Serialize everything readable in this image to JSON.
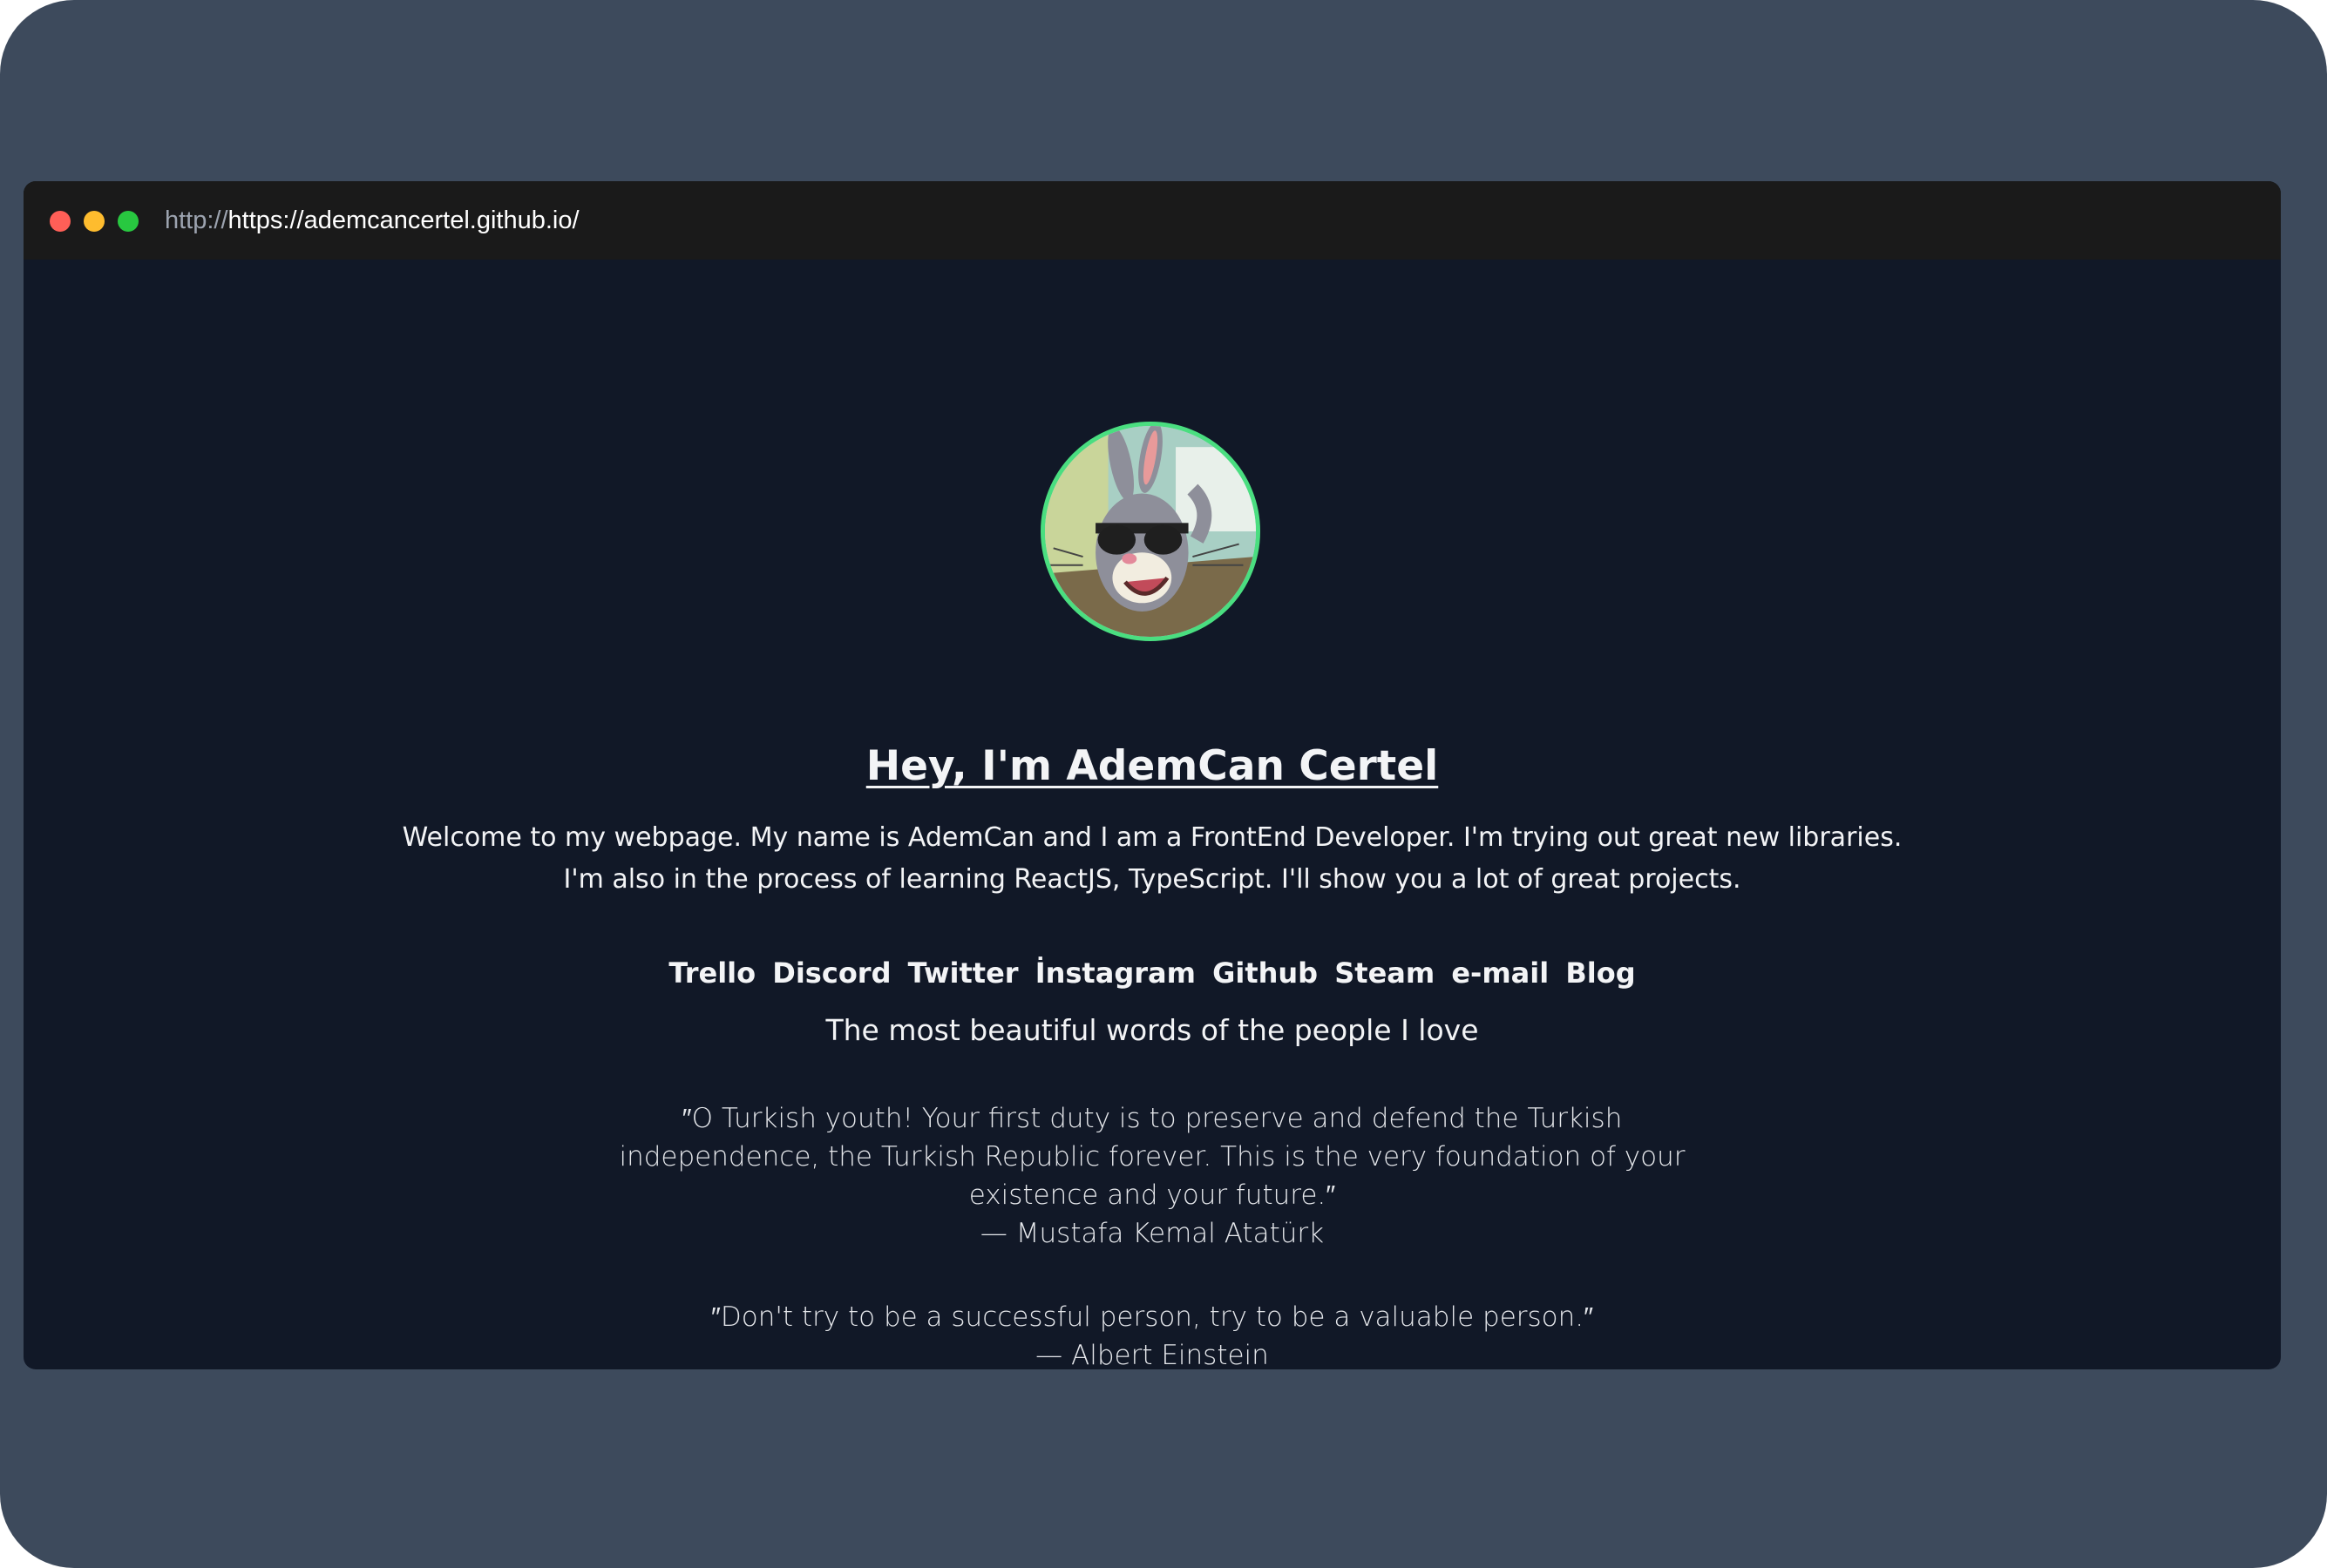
{
  "browser": {
    "url_protocol": "http://",
    "url_host": "https://ademcancertel.github.io/"
  },
  "profile": {
    "heading": "Hey, I'm AdemCan Certel",
    "intro_line1": "Welcome to my webpage. My name is AdemCan and I am a FrontEnd Developer. I'm trying out great new libraries.",
    "intro_line2": "I'm also in the process of learning ReactJS, TypeScript. I'll show you a lot of great projects."
  },
  "social_links": [
    "Trello",
    "Discord",
    "Twitter",
    "İnstagram",
    "Github",
    "Steam",
    "e-mail",
    "Blog"
  ],
  "quotes_section": {
    "title": "The most beautiful words of the people I love",
    "quotes": [
      {
        "line1": "″O Turkish youth! Your first duty is to preserve and defend the Turkish",
        "line2": "independence, the Turkish Republic forever. This is the very foundation of your",
        "line3": "existence and your future.″",
        "author": "— Mustafa Kemal Atatürk"
      },
      {
        "line1": "″Don't try to be a successful person, try to be a valuable person.″",
        "author": "— Albert Einstein"
      }
    ]
  },
  "colors": {
    "outer_background": "#3d4a5c",
    "page_background": "#111827",
    "titlebar": "#1a1a1a",
    "accent_green": "#4ade80",
    "text": "#f3f4f6"
  },
  "icons": {
    "close_dot": "red-dot-icon",
    "minimize_dot": "yellow-dot-icon",
    "maximize_dot": "green-dot-icon"
  }
}
